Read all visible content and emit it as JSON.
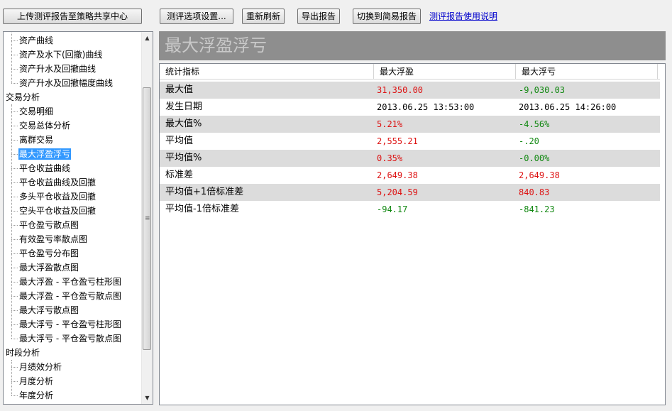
{
  "toolbar": {
    "upload_label": "上传测评报告至策略共享中心",
    "options_label": "测评选项设置...",
    "refresh_label": "重新刷新",
    "export_label": "导出报告",
    "switch_label": "切换到简易报告",
    "help_link": "测评报告使用说明"
  },
  "tree": {
    "items": [
      {
        "label": "资产曲线",
        "level": 1
      },
      {
        "label": "资产及水下(回撤)曲线",
        "level": 1
      },
      {
        "label": "资产升水及回撤曲线",
        "level": 1
      },
      {
        "label": "资产升水及回撤幅度曲线",
        "level": 1
      },
      {
        "label": "交易分析",
        "level": 0
      },
      {
        "label": "交易明细",
        "level": 1
      },
      {
        "label": "交易总体分析",
        "level": 1
      },
      {
        "label": "离群交易",
        "level": 1
      },
      {
        "label": "最大浮盈浮亏",
        "level": 1,
        "selected": true
      },
      {
        "label": "平仓收益曲线",
        "level": 1
      },
      {
        "label": "平仓收益曲线及回撤",
        "level": 1
      },
      {
        "label": "多头平仓收益及回撤",
        "level": 1
      },
      {
        "label": "空头平仓收益及回撤",
        "level": 1
      },
      {
        "label": "平仓盈亏散点图",
        "level": 1
      },
      {
        "label": "有效盈亏率散点图",
        "level": 1
      },
      {
        "label": "平仓盈亏分布图",
        "level": 1
      },
      {
        "label": "最大浮盈散点图",
        "level": 1
      },
      {
        "label": "最大浮盈 - 平仓盈亏柱形图",
        "level": 1
      },
      {
        "label": "最大浮盈 - 平仓盈亏散点图",
        "level": 1
      },
      {
        "label": "最大浮亏散点图",
        "level": 1
      },
      {
        "label": "最大浮亏 - 平仓盈亏柱形图",
        "level": 1
      },
      {
        "label": "最大浮亏 - 平仓盈亏散点图",
        "level": 1
      },
      {
        "label": "时段分析",
        "level": 0
      },
      {
        "label": "月绩效分析",
        "level": 1
      },
      {
        "label": "月度分析",
        "level": 1
      },
      {
        "label": "年度分析",
        "level": 1
      }
    ]
  },
  "report": {
    "title": "最大浮盈浮亏",
    "columns": [
      "统计指标",
      "最大浮盈",
      "最大浮亏"
    ],
    "rows": [
      {
        "label": "最大值",
        "v1": "31,350.00",
        "v1_color": "pos",
        "v2": "-9,030.03",
        "v2_color": "neg"
      },
      {
        "label": "发生日期",
        "v1": "2013.06.25 13:53:00",
        "v1_color": "neu",
        "v2": "2013.06.25 14:26:00",
        "v2_color": "neu"
      },
      {
        "label": "最大值%",
        "v1": "5.21%",
        "v1_color": "pos",
        "v2": "-4.56%",
        "v2_color": "neg"
      },
      {
        "label": "平均值",
        "v1": "2,555.21",
        "v1_color": "pos",
        "v2": "-.20",
        "v2_color": "neg"
      },
      {
        "label": "平均值%",
        "v1": "0.35%",
        "v1_color": "pos",
        "v2": "-0.00%",
        "v2_color": "neg"
      },
      {
        "label": "标准差",
        "v1": "2,649.38",
        "v1_color": "pos",
        "v2": "2,649.38",
        "v2_color": "pos"
      },
      {
        "label": "平均值+1倍标准差",
        "v1": "5,204.59",
        "v1_color": "pos",
        "v2": "840.83",
        "v2_color": "pos"
      },
      {
        "label": "平均值-1倍标准差",
        "v1": "-94.17",
        "v1_color": "neg",
        "v2": "-841.23",
        "v2_color": "neg"
      }
    ]
  },
  "colors": {
    "positive": "#dd1111",
    "negative": "#118811",
    "selection": "#3399ff",
    "banner": "#8e8e8e"
  },
  "icons": {
    "scroll_up": "triangle-up",
    "scroll_down": "triangle-down",
    "scroll_grip": "grip-lines"
  }
}
